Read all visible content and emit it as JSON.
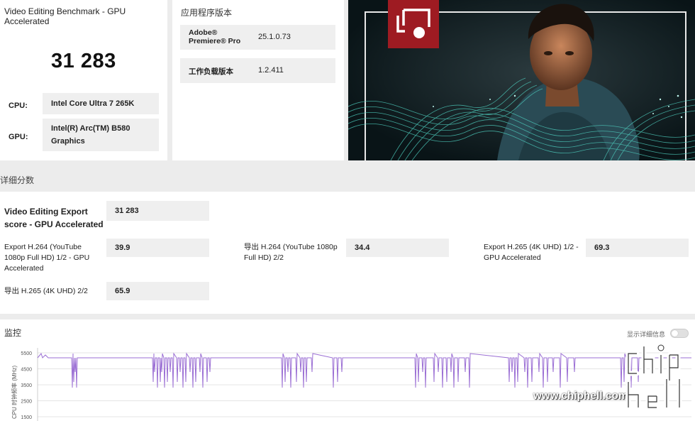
{
  "benchmark": {
    "title": "Video Editing Benchmark - GPU Accelerated",
    "score": "31 283",
    "cpu_label": "CPU:",
    "cpu_value": "Intel Core Ultra 7 265K",
    "gpu_label": "GPU:",
    "gpu_value": "Intel(R) Arc(TM) B580 Graphics"
  },
  "app_version": {
    "title": "应用程序版本",
    "rows": [
      {
        "label": "Adobe® Premiere® Pro",
        "value": "25.1.0.73"
      },
      {
        "label": "工作负载版本",
        "value": "1.2.411"
      }
    ]
  },
  "details": {
    "title": "详细分数",
    "export_score_label": "Video Editing Export score - GPU Accelerated",
    "export_score_value": "31 283",
    "items": [
      {
        "label": "Export H.264 (YouTube 1080p Full HD) 1/2 - GPU Accelerated",
        "value": "39.9"
      },
      {
        "label": "导出 H.264 (YouTube 1080p Full HD) 2/2",
        "value": "34.4"
      },
      {
        "label": "Export H.265 (4K UHD) 1/2 - GPU Accelerated",
        "value": "69.3"
      },
      {
        "label": "导出 H.265 (4K UHD) 2/2",
        "value": "65.9"
      }
    ]
  },
  "monitoring": {
    "title": "监控",
    "toggle_label": "显示详细信息",
    "toggle_on": false,
    "y_axis_label": "CPU 时钟频率 (MHz)",
    "y_ticks": [
      "5500",
      "4500",
      "3500",
      "2500",
      "1500"
    ],
    "line_color": "#9b6fd4"
  },
  "watermark": {
    "text": "www.chiphell.com",
    "logo": "chip hell"
  },
  "colors": {
    "brand_red": "#9e1b22",
    "background": "#ececec",
    "card": "#ffffff"
  }
}
